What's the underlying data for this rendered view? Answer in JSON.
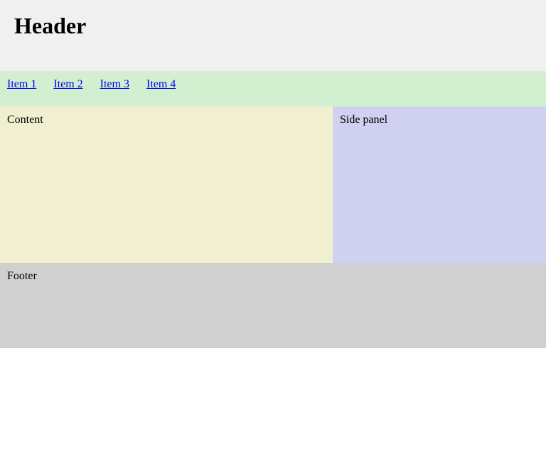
{
  "header": {
    "title": "Header"
  },
  "nav": {
    "items": [
      {
        "label": "Item 1"
      },
      {
        "label": "Item 2"
      },
      {
        "label": "Item 3"
      },
      {
        "label": "Item 4"
      }
    ]
  },
  "content": {
    "text": "Content"
  },
  "side_panel": {
    "text": "Side panel"
  },
  "footer": {
    "text": "Footer"
  },
  "colors": {
    "header_bg": "#f0f0f0",
    "nav_bg": "#d2f0d0",
    "content_bg": "#f0f0d0",
    "side_bg": "#d0d0f0",
    "footer_bg": "#d0d0d0",
    "link": "#0000ee"
  }
}
